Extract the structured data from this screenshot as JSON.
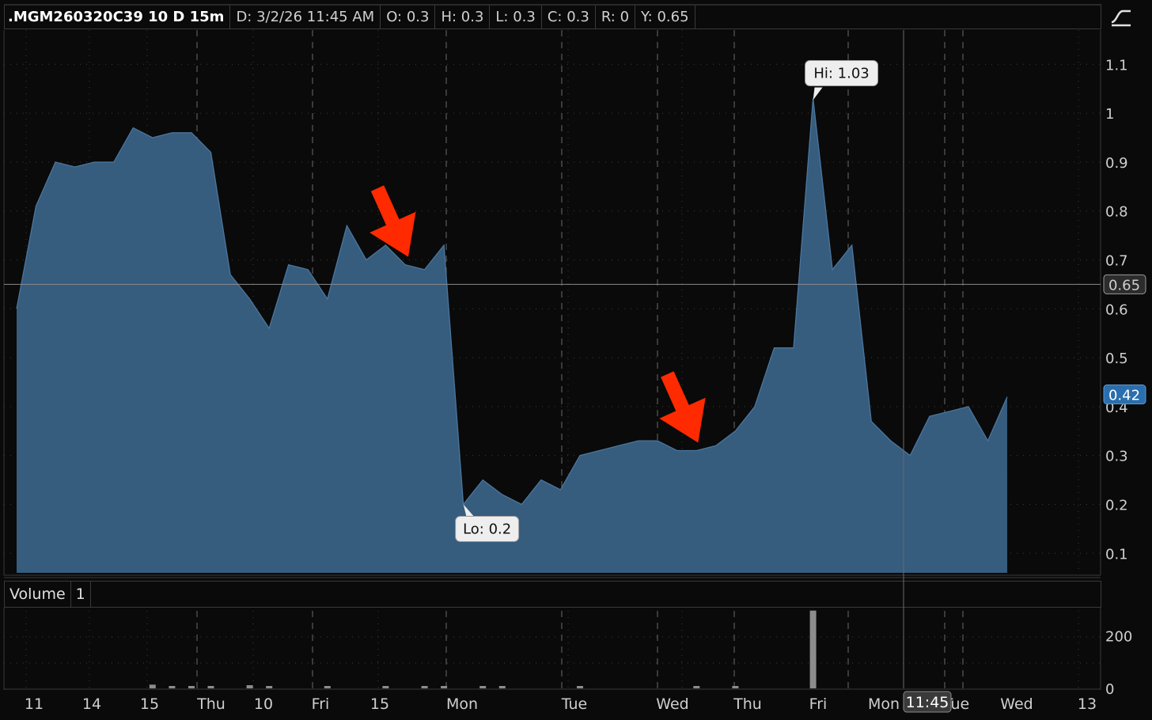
{
  "header": {
    "symbol": ".MGM260320C39 10 D 15m",
    "date": "D: 3/2/26 11:45 AM",
    "open": "O: 0.3",
    "high": "H: 0.3",
    "low": "L: 0.3",
    "close": "C: 0.3",
    "range": "R: 0",
    "y": "Y: 0.65"
  },
  "tools": {
    "icon": "drawing-tool-icon"
  },
  "volume_panel": {
    "title": "Volume",
    "value": "1"
  },
  "crosshair": {
    "price_label": "0.65",
    "time_label": "11:45"
  },
  "last_price_label": "0.42",
  "callouts": {
    "high": "Hi: 1.03",
    "low": "Lo: 0.2"
  },
  "colors": {
    "area_fill": "#365c7e",
    "area_line": "#4a769e",
    "last_price_bg": "#2a6ead",
    "arrow": "#ff2a00",
    "volume_bar": "#8c8c8c"
  },
  "chart_data": [
    {
      "type": "area",
      "title": ".MGM260320C39 10 D 15m",
      "xlabel": "",
      "ylabel": "",
      "ylim": [
        0.06,
        1.17
      ],
      "y_ticks": [
        "0.1",
        "0.2",
        "0.3",
        "0.4",
        "0.5",
        "0.6",
        "0.7",
        "0.8",
        "0.9",
        "1",
        "1.1"
      ],
      "x_tick_labels": [
        "11",
        "14",
        "15",
        "Thu",
        "10",
        "Fri",
        "15",
        "Mon",
        "Tue",
        "Wed",
        "Thu",
        "Fri",
        "Mon",
        "Tue",
        "Wed",
        "13"
      ],
      "grid": true,
      "series": [
        {
          "values": [
            0.6,
            0.81,
            0.9,
            0.89,
            0.9,
            0.9,
            0.97,
            0.95,
            0.96,
            0.96,
            0.92,
            0.67,
            0.62,
            0.56,
            0.69,
            0.68,
            0.62,
            0.77,
            0.7,
            0.73,
            0.69,
            0.68,
            0.73,
            0.2,
            0.25,
            0.22,
            0.2,
            0.25,
            0.23,
            0.3,
            0.31,
            0.32,
            0.33,
            0.33,
            0.31,
            0.31,
            0.32,
            0.35,
            0.4,
            0.52,
            0.52,
            1.03,
            0.68,
            0.73,
            0.37,
            0.33,
            0.3,
            0.38,
            0.39,
            0.4,
            0.33,
            0.42
          ]
        }
      ],
      "annotations": [
        "Hi: 1.03",
        "Lo: 0.2"
      ]
    },
    {
      "type": "bar",
      "title": "Volume",
      "y_ticks": [
        "0",
        "200"
      ],
      "ylim": [
        0,
        300
      ],
      "values": [
        0,
        0,
        0,
        0,
        0,
        0,
        0,
        14,
        2,
        2,
        3,
        0,
        12,
        3,
        0,
        0,
        1,
        0,
        0,
        1,
        0,
        4,
        5,
        0,
        1,
        1,
        0,
        0,
        0,
        1,
        0,
        0,
        0,
        0,
        0,
        3,
        0,
        3,
        0,
        0,
        0,
        295,
        0,
        0,
        0,
        0,
        0,
        0,
        0,
        0,
        0,
        0
      ]
    }
  ]
}
